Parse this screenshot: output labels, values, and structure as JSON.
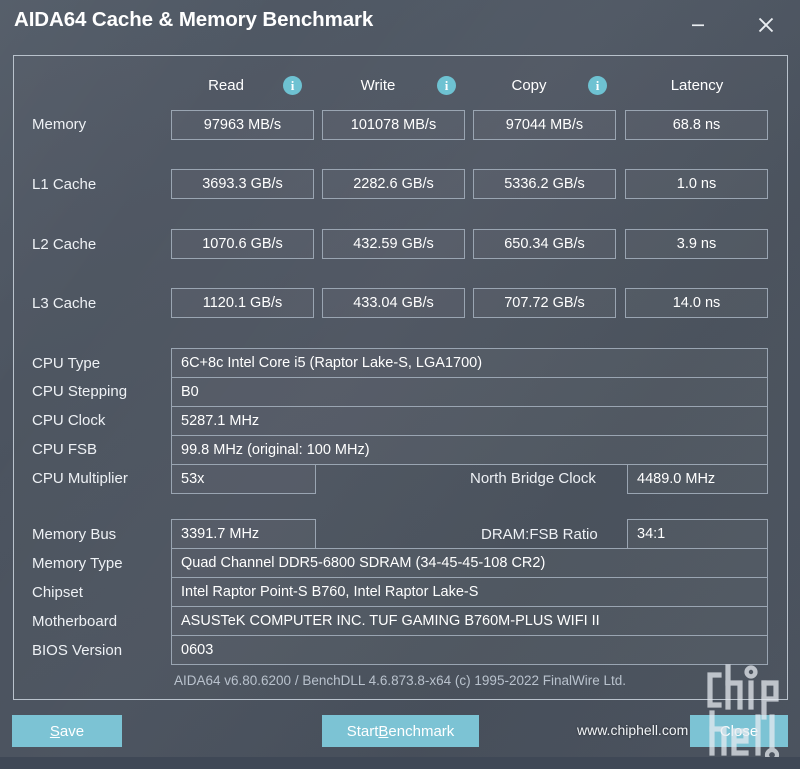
{
  "window": {
    "title": "AIDA64 Cache & Memory Benchmark",
    "minimize_label": "Minimize",
    "close_label": "Close"
  },
  "benchmark": {
    "columns": [
      {
        "label": "Read",
        "has_info": true
      },
      {
        "label": "Write",
        "has_info": true
      },
      {
        "label": "Copy",
        "has_info": true
      },
      {
        "label": "Latency",
        "has_info": false
      }
    ],
    "rows": [
      {
        "label": "Memory",
        "read": "97963 MB/s",
        "write": "101078 MB/s",
        "copy": "97044 MB/s",
        "latency": "68.8 ns"
      },
      {
        "label": "L1 Cache",
        "read": "3693.3 GB/s",
        "write": "2282.6 GB/s",
        "copy": "5336.2 GB/s",
        "latency": "1.0 ns"
      },
      {
        "label": "L2 Cache",
        "read": "1070.6 GB/s",
        "write": "432.59 GB/s",
        "copy": "650.34 GB/s",
        "latency": "3.9 ns"
      },
      {
        "label": "L3 Cache",
        "read": "1120.1 GB/s",
        "write": "433.04 GB/s",
        "copy": "707.72 GB/s",
        "latency": "14.0 ns"
      }
    ]
  },
  "cpu_info": {
    "type_label": "CPU Type",
    "type_value": "6C+8c Intel Core i5  (Raptor Lake-S, LGA1700)",
    "stepping_label": "CPU Stepping",
    "stepping_value": "B0",
    "clock_label": "CPU Clock",
    "clock_value": "5287.1 MHz",
    "fsb_label": "CPU FSB",
    "fsb_value": "99.8 MHz  (original: 100 MHz)",
    "multiplier_label": "CPU Multiplier",
    "multiplier_value": "53x",
    "north_bridge_label": "North Bridge Clock",
    "north_bridge_value": "4489.0 MHz"
  },
  "system_info": {
    "membus_label": "Memory Bus",
    "membus_value": "3391.7 MHz",
    "dram_ratio_label": "DRAM:FSB Ratio",
    "dram_ratio_value": "34:1",
    "memtype_label": "Memory Type",
    "memtype_value": "Quad Channel DDR5-6800 SDRAM  (34-45-45-108 CR2)",
    "chipset_label": "Chipset",
    "chipset_value": "Intel Raptor Point-S B760, Intel Raptor Lake-S",
    "motherboard_label": "Motherboard",
    "motherboard_value": "ASUSTeK COMPUTER INC. TUF GAMING B760M-PLUS WIFI II",
    "bios_label": "BIOS Version",
    "bios_value": "0603"
  },
  "footer": {
    "version_line": "AIDA64 v6.80.6200 / BenchDLL 4.6.873.8-x64  (c) 1995-2022 FinalWire Ltd.",
    "save_prefix": "",
    "save_accel": "S",
    "save_suffix": "ave",
    "start_prefix": "Start ",
    "start_accel": "B",
    "start_suffix": "enchmark",
    "close_button_label": "Close",
    "watermark_url": "www.chiphell.com",
    "watermark_text": "chiphell"
  },
  "info_glyph": "i",
  "colors": {
    "accent": "#7cc3d4",
    "panel_border": "#b9c2cc",
    "background": "#4b535f",
    "box_border": "#9aa5b2",
    "text": "#ffffff",
    "muted_text": "#b9c2cd"
  }
}
